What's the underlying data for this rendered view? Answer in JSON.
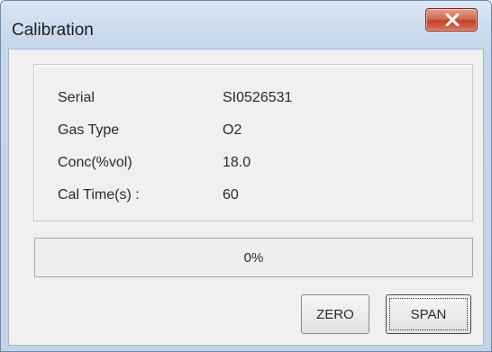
{
  "window": {
    "title": "Calibration"
  },
  "info": [
    {
      "label": "Serial",
      "value": "SI0526531"
    },
    {
      "label": "Gas Type",
      "value": "O2"
    },
    {
      "label": "Conc(%vol)",
      "value": "18.0"
    },
    {
      "label": "Cal Time(s)  :",
      "value": "60"
    }
  ],
  "progress": {
    "value": 0,
    "text": "0%"
  },
  "buttons": {
    "zero_label": "ZERO",
    "span_label": "SPAN"
  },
  "icons": {
    "close": "close-icon"
  },
  "colors": {
    "close_button": "#c2432b",
    "titlebar": "#cddcee",
    "client_background": "#f0f0f0"
  }
}
